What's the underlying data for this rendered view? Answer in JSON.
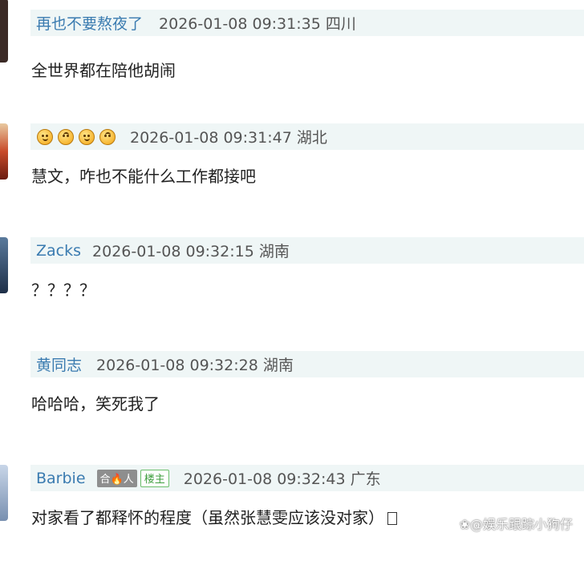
{
  "comments": [
    {
      "username": "再也不要熬夜了",
      "timestamp": "2026-01-08 09:31:35",
      "location": "四川",
      "text": "全世界都在陪他胡闹",
      "avatar_color": "#3b2a26"
    },
    {
      "username_emojis": [
        "slightly-smiling-face-icon",
        "upside-down-face-icon",
        "slightly-smiling-face-icon",
        "upside-down-face-icon"
      ],
      "timestamp": "2026-01-08 09:31:47",
      "location": "湖北",
      "text": "慧文，咋也不能什么工作都接吧",
      "avatar_color": "#c84a2a"
    },
    {
      "username": "Zacks",
      "timestamp": "2026-01-08 09:32:15",
      "location": "湖南",
      "text": "？？？？",
      "avatar_color": "#2f4a6b"
    },
    {
      "username": "黄同志",
      "timestamp": "2026-01-08 09:32:28",
      "location": "湖南",
      "text": "哈哈哈，笑死我了",
      "avatar_color": "#ffffff"
    },
    {
      "username": "Barbie",
      "badge_fan": "合🔥人",
      "badge_op": "楼主",
      "timestamp": "2026-01-08 09:32:43",
      "location": "广东",
      "text": "对家看了都释怀的程度（虽然张慧雯应该没对家）",
      "avatar_color": "#8fa8c8"
    }
  ],
  "watermark": "❀@娱乐跟踪小狗仔",
  "colors": {
    "header_bg": "#eff6f6",
    "username": "#3a7bb0",
    "meta": "#555555",
    "text": "#222222"
  }
}
